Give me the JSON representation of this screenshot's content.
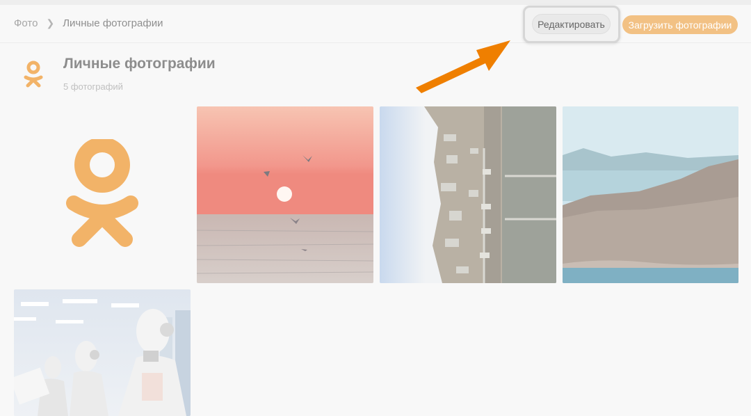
{
  "breadcrumb": {
    "root": "Фото",
    "current": "Личные фотографии"
  },
  "toolbar": {
    "edit_label": "Редактировать",
    "upload_label": "Загрузить фотографии"
  },
  "album": {
    "title": "Личные фотографии",
    "count": "5 фотографий"
  },
  "icons": {
    "separator": "chevron-right-icon",
    "album": "odnoklassniki-logo",
    "arrow": "orange-arrow"
  },
  "colors": {
    "accent": "#f2c184",
    "arrow": "#ef7f00",
    "text_muted": "#a6a6a6"
  },
  "photos": [
    {
      "name": "sunset-sea-gulls"
    },
    {
      "name": "aerial-coastal-town"
    },
    {
      "name": "coastal-cliffs"
    },
    {
      "name": "robots-office"
    }
  ]
}
